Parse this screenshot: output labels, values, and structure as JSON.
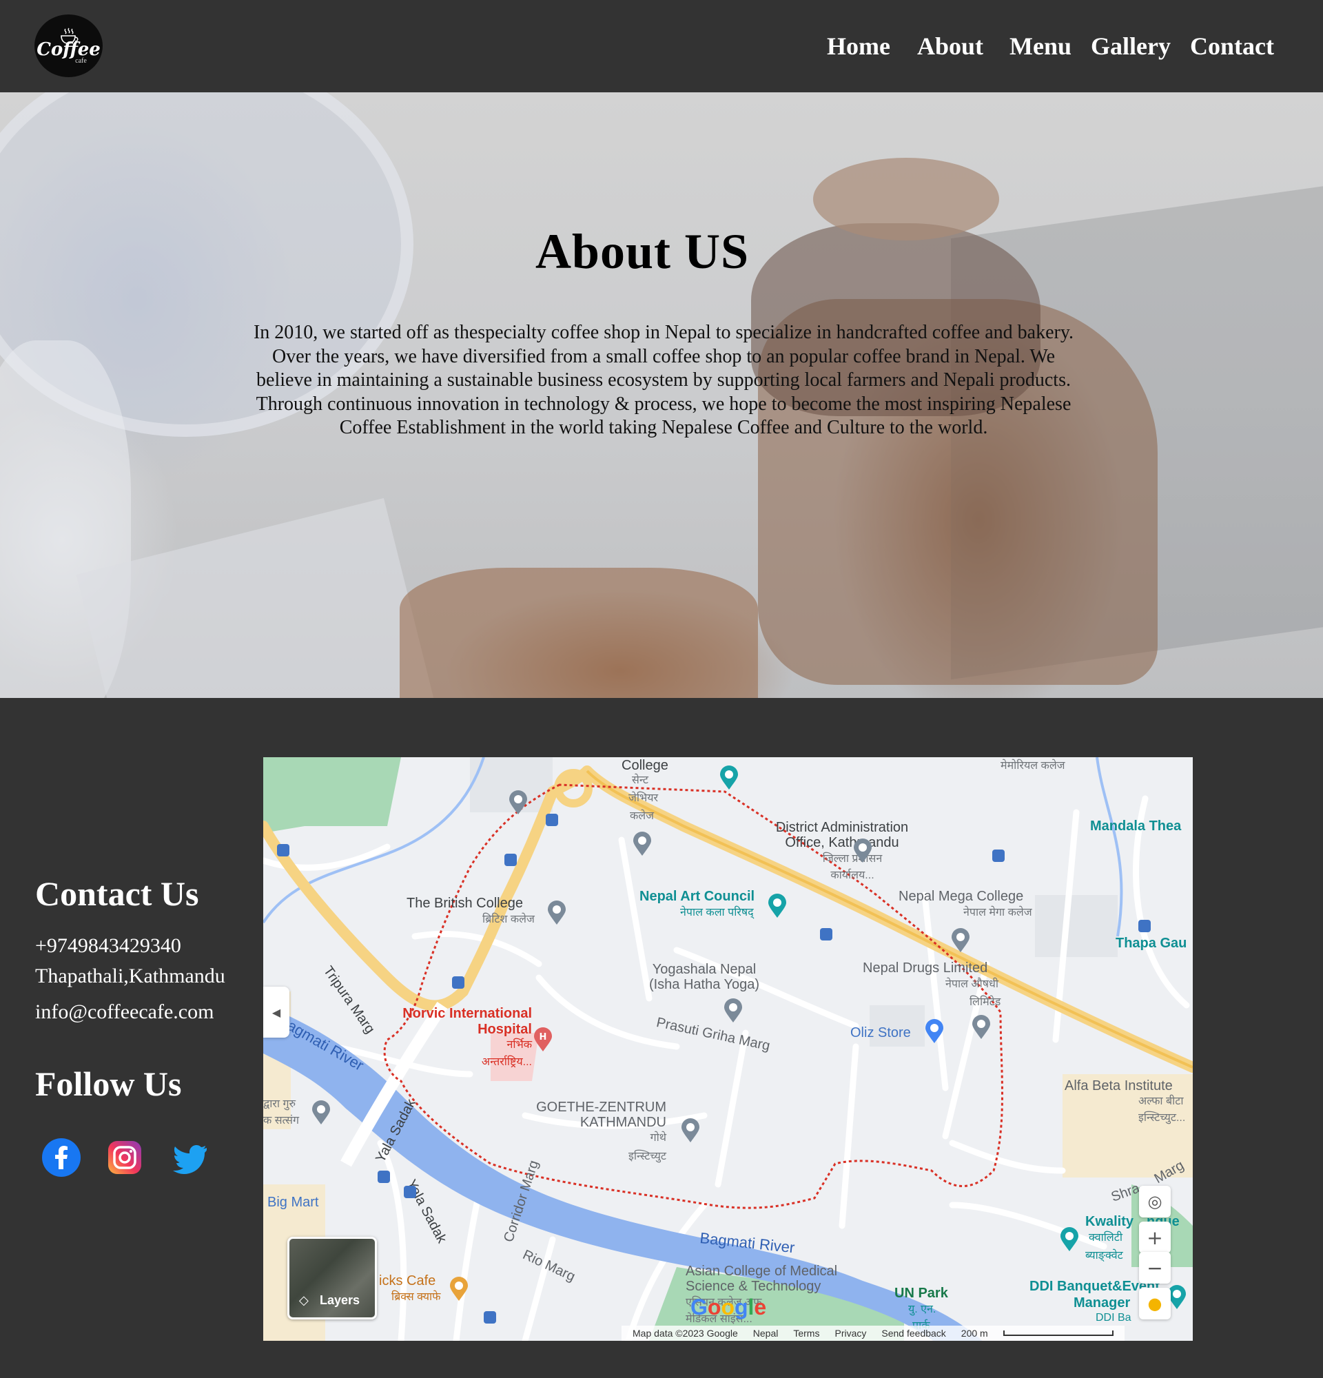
{
  "nav": {
    "logo": {
      "word": "Coffee",
      "sub": "cafe"
    },
    "links": [
      "Home",
      "About",
      "Menu",
      "Gallery",
      "Contact"
    ]
  },
  "hero": {
    "title": "About US",
    "text": "In 2010, we started off as thespecialty coffee shop in Nepal to specialize in handcrafted coffee and bakery. Over the years, we have diversified from a small coffee shop to an popular coffee brand in Nepal. We believe in maintaining a sustainable business ecosystem by supporting local farmers and Nepali products. Through continuous innovation in technology & process, we hope to become the most inspiring Nepalese Coffee Establishment in the world taking Nepalese Coffee and Culture to the world."
  },
  "contact": {
    "title": "Contact Us",
    "phone": "+9749843429340",
    "address": "Thapathali,Kathmandu",
    "email": "info@coffeecafe.com"
  },
  "follow": {
    "title": "Follow Us",
    "icons": [
      "facebook-icon",
      "instagram-icon",
      "twitter-icon"
    ]
  },
  "map": {
    "labels": {
      "college": "College",
      "college_np1": "सेन्ट",
      "college_np2": "जेभियर",
      "college_np3": "कलेज",
      "memorial": "मेमोरियल कलेज",
      "dao1": "District Administration",
      "dao2": "Office, Kathmandu",
      "dao_np1": "जिल्ला प्रशासन",
      "dao_np2": "कार्यालय...",
      "mandala": "Mandala Thea",
      "nac": "Nepal Art Council",
      "nac_np": "नेपाल कला परिषद्",
      "british": "The British College",
      "british_np": "ब्रिटिश कलेज",
      "mega": "Nepal Mega College",
      "mega_np": "नेपाल मेगा कलेज",
      "thapa": "Thapa Gau",
      "tripura": "Tripura Marg",
      "yoga1": "Yogashala Nepal",
      "yoga2": "(Isha Hatha Yoga)",
      "drugs": "Nepal Drugs Limited",
      "drugs_np1": "नेपाल औषधी",
      "drugs_np2": "लिमिटेड",
      "prasuti": "Prasuti Griha Marg",
      "norvic1": "Norvic International",
      "norvic2": "Hospital",
      "norvic_np1": "नर्भिक",
      "norvic_np2": "अन्तर्राष्ट्रिय...",
      "oliz": "Oliz Store",
      "bagmati_left": "Bagmati River",
      "guru1": "द्वारा गुरु",
      "guru2": "क सत्संग",
      "alfa": "Alfa Beta Institute",
      "alfa_np1": "अल्फा बीटा",
      "alfa_np2": "इन्स्टिच्युट...",
      "goethe1": "GOETHE-ZENTRUM",
      "goethe2": "KATHMANDU",
      "goethe_np1": "गोथे",
      "goethe_np2": "इन्स्टिच्युट",
      "yala1": "Yala Sadak",
      "yala2": "Yala Sadak",
      "bigmart": "Big Mart",
      "shra": "Shra",
      "marg": "Marg",
      "kwality1": "Kwality",
      "kwality2": "nque",
      "kwality_np1": "क्वालिटी",
      "kwality_np2": "ब्याङ्क्वेट",
      "bagmati": "Bagmati River",
      "corridor": "Corridor Marg",
      "rio": "Rio Marg",
      "bricks": "icks Cafe",
      "bricks_np": "ब्रिक्स क्याफे",
      "asian1": "Asian College of Medical",
      "asian2": "Science & Technology",
      "asian_np1": "एसियन कलेज अफ",
      "asian_np2": "मेडिकल साइंस...",
      "unpark": "UN Park",
      "unpark_np1": "यु. एन.",
      "unpark_np2": "पार्क",
      "ddi1": "DDI Banquet&Event",
      "ddi2": "Manager",
      "ddi3": "DDI Ba"
    },
    "layers": "Layers",
    "google": "Google",
    "attribution": [
      "Map data ©2023 Google",
      "Nepal",
      "Terms",
      "Privacy",
      "Send feedback",
      "200 m"
    ]
  }
}
